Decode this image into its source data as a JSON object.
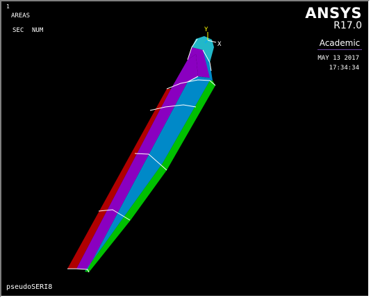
{
  "window": {
    "number": "1",
    "plot_type": "AREAS",
    "numbering_sec": "SEC",
    "numbering_num": "NUM",
    "title": "pseudoSERI8"
  },
  "brand": {
    "name": "ANSYS",
    "version": "R17.0",
    "edition": "Academic"
  },
  "timestamp": {
    "date": "MAY 13 2017",
    "time": "17:34:34"
  },
  "triad": {
    "x_label": "X",
    "y_label": "Y",
    "x_color": "#ffffff",
    "y_color": "#ffff00"
  },
  "colors": {
    "background": "#000000",
    "red_area": "#b00000",
    "purple_area": "#8a00c0",
    "blue_area": "#0089c8",
    "green_area": "#00c000",
    "cyan_area": "#22b8c8",
    "edge_lines": "#ffffff"
  }
}
